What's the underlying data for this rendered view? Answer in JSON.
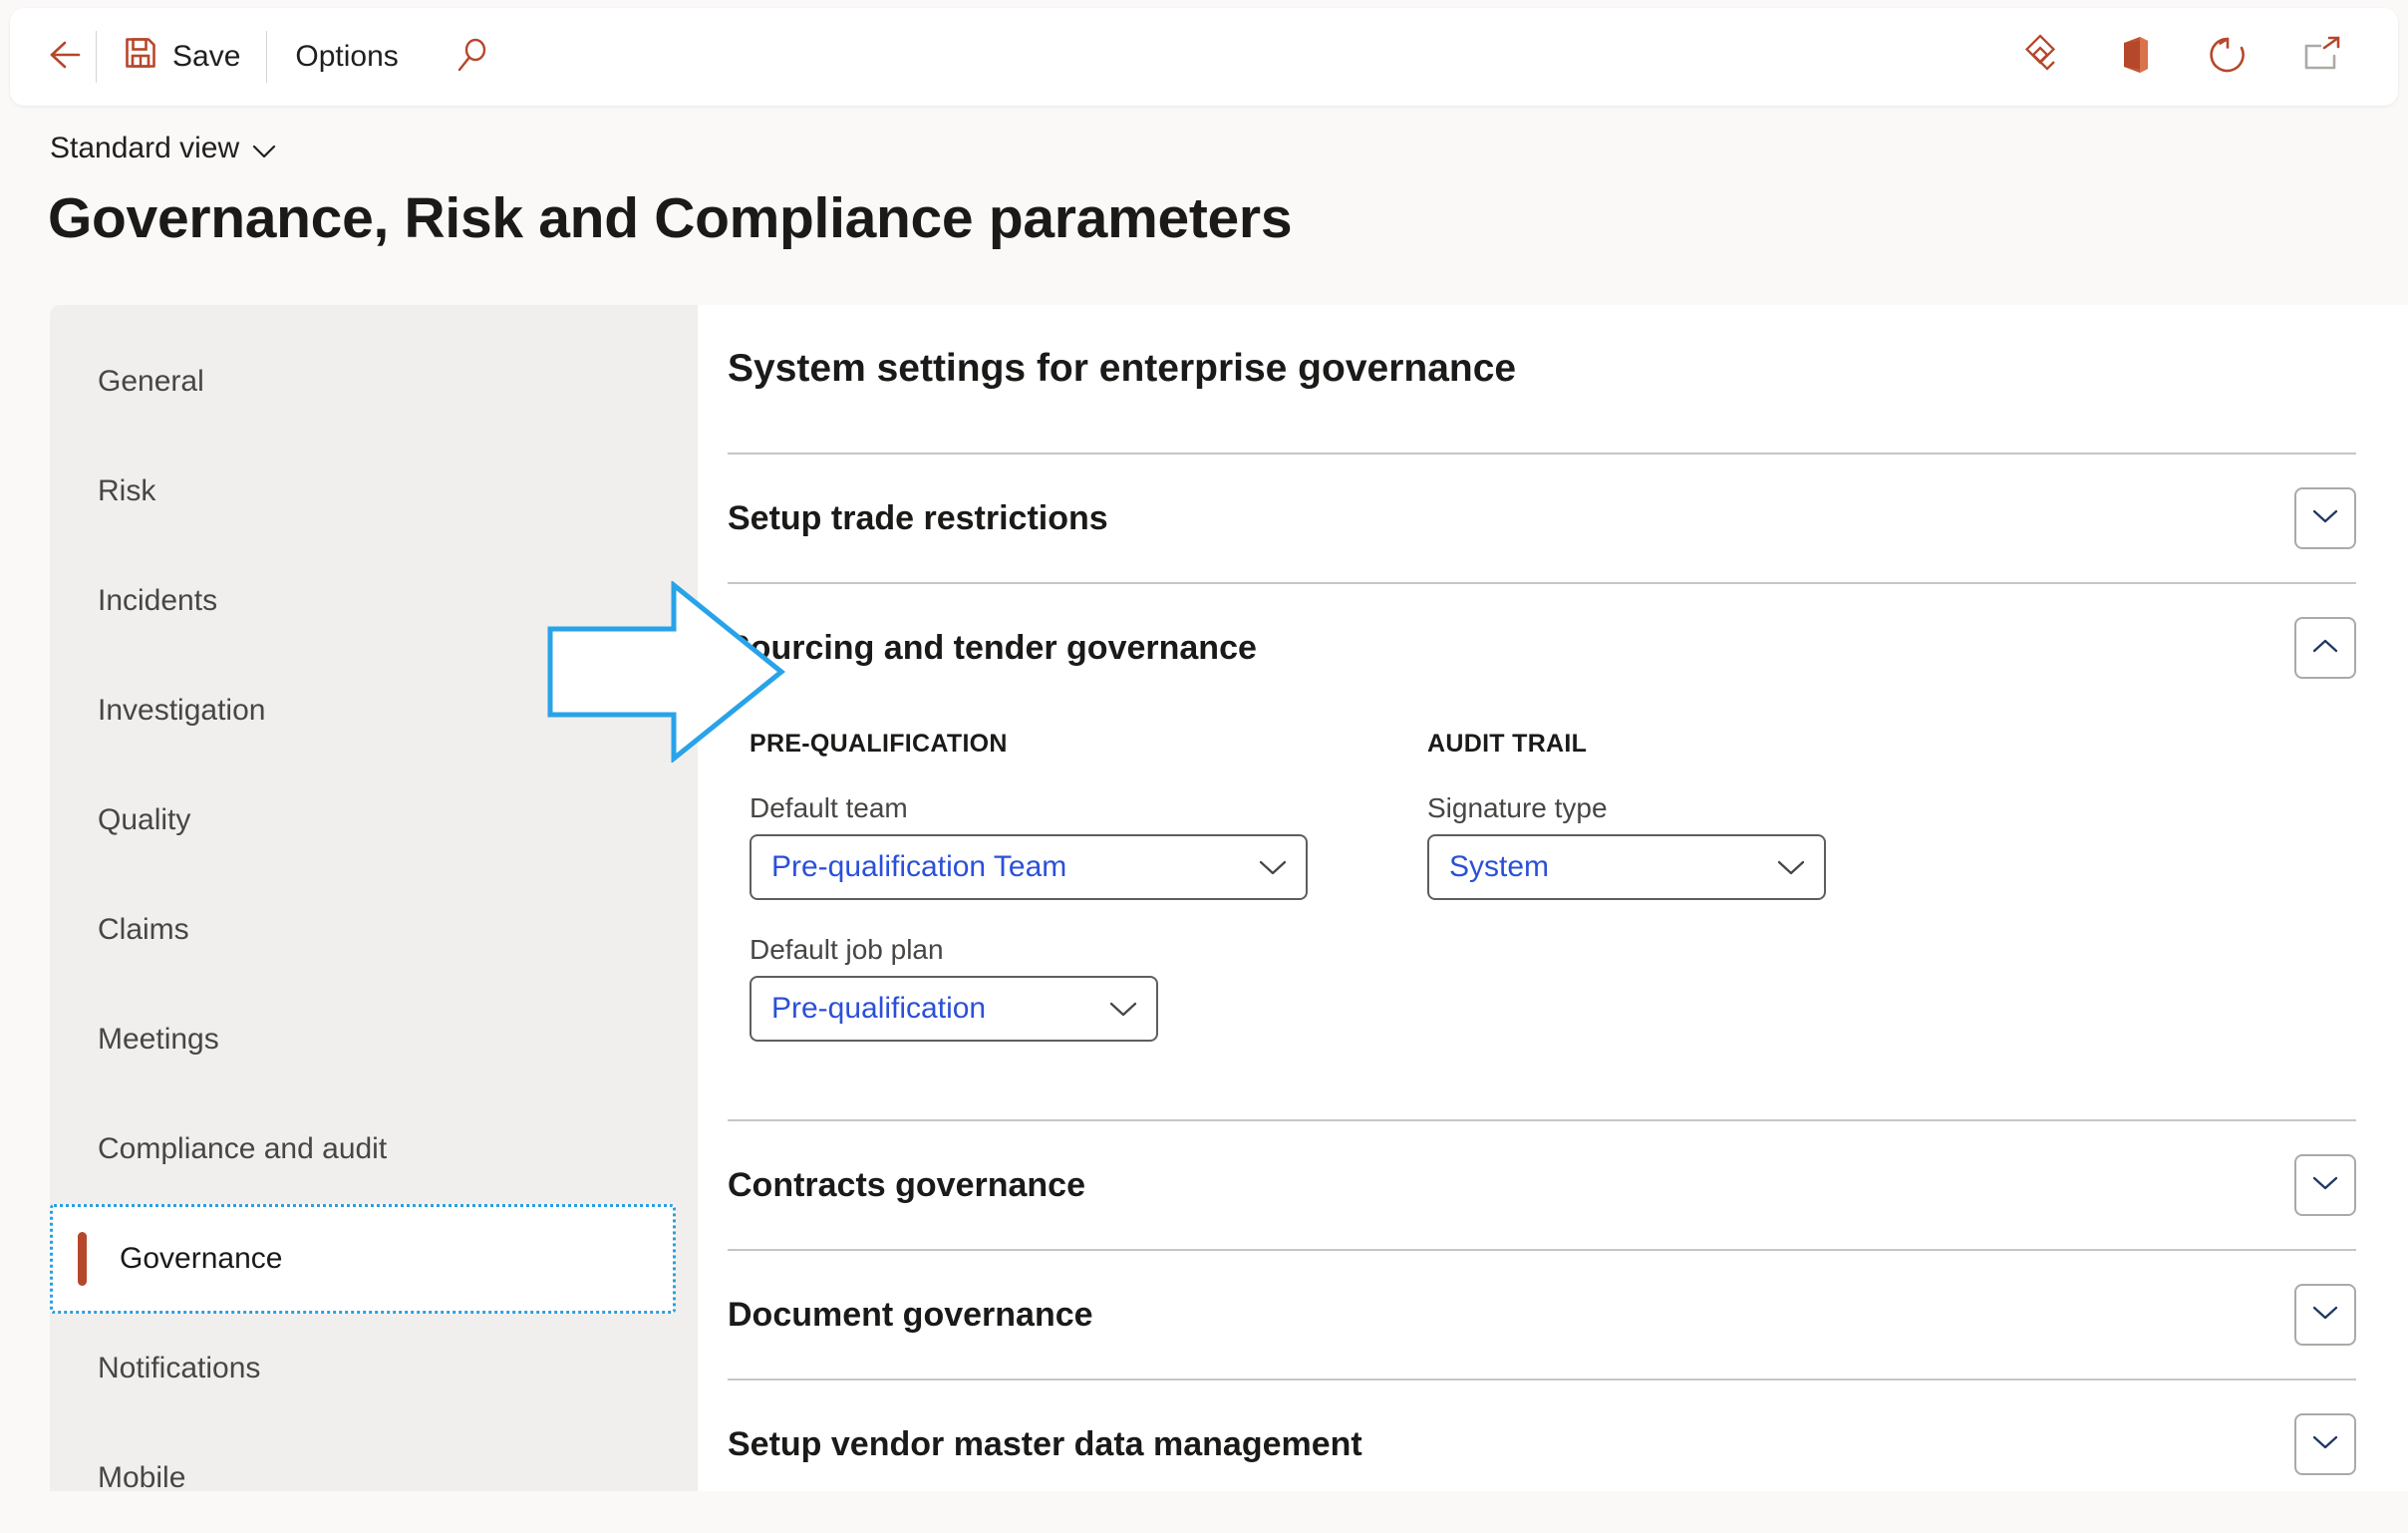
{
  "commandbar": {
    "back_icon": "back-arrow-icon",
    "save_label": "Save",
    "save_icon": "floppy-disk-save-icon",
    "options_label": "Options",
    "search_icon": "magnifier-search-icon",
    "right_icons": [
      {
        "name": "diamond-attachments-icon"
      },
      {
        "name": "office-app-icon"
      },
      {
        "name": "refresh-icon"
      },
      {
        "name": "open-in-new-window-icon"
      }
    ]
  },
  "header": {
    "view_label": "Standard view",
    "view_chevron": "chevron-down-icon",
    "title": "Governance, Risk and Compliance parameters"
  },
  "sidebar": {
    "items": [
      {
        "label": "General",
        "selected": false
      },
      {
        "label": "Risk",
        "selected": false
      },
      {
        "label": "Incidents",
        "selected": false
      },
      {
        "label": "Investigation",
        "selected": false
      },
      {
        "label": "Quality",
        "selected": false
      },
      {
        "label": "Claims",
        "selected": false
      },
      {
        "label": "Meetings",
        "selected": false
      },
      {
        "label": "Compliance and audit",
        "selected": false
      },
      {
        "label": "Governance",
        "selected": true
      },
      {
        "label": "Notifications",
        "selected": false
      },
      {
        "label": "Mobile",
        "selected": false
      }
    ]
  },
  "content": {
    "title": "System settings for enterprise governance",
    "sections": [
      {
        "title": "Setup trade restrictions",
        "expanded": false,
        "chevron": "chevron-down-icon"
      },
      {
        "title": "Sourcing and tender governance",
        "expanded": true,
        "chevron": "chevron-up-icon"
      },
      {
        "title": "Contracts governance",
        "expanded": false,
        "chevron": "chevron-down-icon"
      },
      {
        "title": "Document governance",
        "expanded": false,
        "chevron": "chevron-down-icon"
      },
      {
        "title": "Setup vendor master data management",
        "expanded": false,
        "chevron": "chevron-down-icon"
      }
    ],
    "sourcing": {
      "prequalification": {
        "group_label": "PRE-QUALIFICATION",
        "default_team": {
          "label": "Default team",
          "value": "Pre-qualification Team",
          "chevron": "chevron-down-icon"
        },
        "default_job_plan": {
          "label": "Default job plan",
          "value": "Pre-qualification",
          "chevron": "chevron-down-icon"
        }
      },
      "audit_trail": {
        "group_label": "AUDIT TRAIL",
        "signature_type": {
          "label": "Signature type",
          "value": "System",
          "chevron": "chevron-down-icon"
        }
      }
    }
  },
  "annotation": {
    "arrow_name": "blue-pointer-arrow-annotation",
    "arrow_color": "#29A3E8",
    "points_at": "Sourcing and tender governance"
  },
  "colors": {
    "accent_red": "#B5472A",
    "link_blue": "#2B50D8",
    "sidebar_bg": "#F0EFEE",
    "page_bg": "#FAF9F8",
    "annotation_blue": "#29A3E8"
  }
}
